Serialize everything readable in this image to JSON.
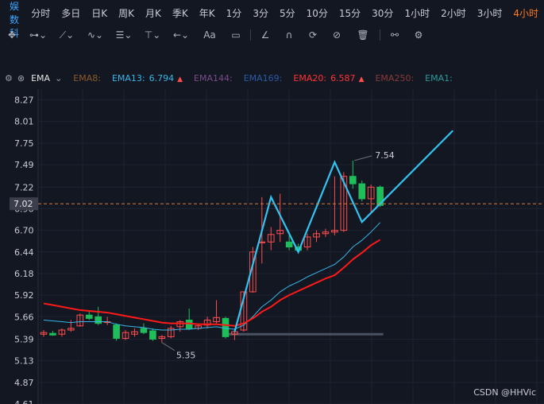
{
  "stock_name": "天娱数科",
  "timeframes": [
    "分时",
    "多日",
    "日K",
    "周K",
    "月K",
    "季K",
    "年K",
    "1分",
    "3分",
    "5分",
    "10分",
    "15分",
    "30分",
    "1小时",
    "2小时",
    "3小时",
    "4小时"
  ],
  "active_timeframe": "4小时",
  "toolbar": {
    "tools": [
      {
        "icon": "crosshair-icon",
        "glyph": "✥"
      },
      {
        "icon": "segment-line-icon",
        "glyph": "⊶⌄"
      },
      {
        "icon": "polyline-icon",
        "glyph": "⟋⌄"
      },
      {
        "icon": "wave-line-icon",
        "glyph": "∿⌄"
      },
      {
        "icon": "channel-icon",
        "glyph": "☰⌄"
      },
      {
        "icon": "vertical-line-icon",
        "glyph": "⊤⌄"
      },
      {
        "icon": "arrow-icon",
        "glyph": "←⌄"
      },
      {
        "icon": "text-icon",
        "glyph": "Aa"
      },
      {
        "icon": "comment-icon",
        "glyph": "▭"
      },
      {
        "icon": "pen-icon",
        "glyph": "∠"
      },
      {
        "icon": "magnet-icon",
        "glyph": "∩"
      },
      {
        "icon": "sync-icon",
        "glyph": "⟳"
      },
      {
        "icon": "hide-icon",
        "glyph": "⊘"
      },
      {
        "icon": "delete-icon",
        "glyph": "🗑"
      },
      {
        "icon": "link-icon",
        "glyph": "⚯"
      },
      {
        "icon": "settings-icon",
        "glyph": "⚙"
      }
    ]
  },
  "indicator_bar": {
    "name": "EMA",
    "items": [
      {
        "label": "EMA8:",
        "value": "",
        "color": "#8b5a2b",
        "arrow": ""
      },
      {
        "label": "EMA13:",
        "value": "6.794",
        "color": "#38b6e8",
        "arrow": "▲",
        "arrow_color": "#ff4d4d"
      },
      {
        "label": "EMA144:",
        "value": "",
        "color": "#7a4a8a",
        "arrow": ""
      },
      {
        "label": "EMA169:",
        "value": "",
        "color": "#2a5aa8",
        "arrow": ""
      },
      {
        "label": "EMA20:",
        "value": "6.587",
        "color": "#ff3333",
        "arrow": "▲",
        "arrow_color": "#ff4d4d"
      },
      {
        "label": "EMA250:",
        "value": "",
        "color": "#8a3a3a",
        "arrow": ""
      },
      {
        "label": "EMA1:",
        "value": "",
        "color": "#2a9a9a",
        "arrow": ""
      }
    ]
  },
  "chart_data": {
    "type": "candlestick",
    "y_ticks": [
      8.27,
      8.01,
      7.75,
      7.49,
      7.22,
      6.96,
      6.7,
      6.44,
      6.18,
      5.92,
      5.66,
      5.39,
      5.13,
      4.87,
      4.61
    ],
    "y_tick_labels": [
      "8.27",
      "8.01",
      "7.75",
      "7.49",
      "7.22",
      "6.96",
      "6.70",
      "6.44",
      "6.18",
      "5.92",
      "5.66",
      "5.39",
      "5.13",
      "4.87",
      "4.61"
    ],
    "ylim": [
      4.61,
      8.4
    ],
    "current_price": 7.02,
    "current_price_label": "7.02",
    "high_label": "7.54",
    "low_label": "5.35",
    "grid": true,
    "colors": {
      "up": "#ff4d4d",
      "down": "#1fbe5a",
      "ema13": "#38b6e8",
      "ema20": "#ff1a1a",
      "pattern": "#33c3f0",
      "level": "#4a5160",
      "price_line": "#d87a3a",
      "price_tag": "#3a3f4b"
    },
    "candles": [
      {
        "o": 5.45,
        "h": 5.5,
        "l": 5.42,
        "c": 5.47
      },
      {
        "o": 5.46,
        "h": 5.49,
        "l": 5.43,
        "c": 5.44
      },
      {
        "o": 5.45,
        "h": 5.52,
        "l": 5.42,
        "c": 5.5
      },
      {
        "o": 5.5,
        "h": 5.62,
        "l": 5.48,
        "c": 5.52
      },
      {
        "o": 5.55,
        "h": 5.7,
        "l": 5.54,
        "c": 5.68
      },
      {
        "o": 5.68,
        "h": 5.72,
        "l": 5.62,
        "c": 5.64
      },
      {
        "o": 5.66,
        "h": 5.78,
        "l": 5.56,
        "c": 5.58
      },
      {
        "o": 5.6,
        "h": 5.66,
        "l": 5.56,
        "c": 5.6
      },
      {
        "o": 5.56,
        "h": 5.58,
        "l": 5.37,
        "c": 5.4
      },
      {
        "o": 5.4,
        "h": 5.5,
        "l": 5.38,
        "c": 5.47
      },
      {
        "o": 5.45,
        "h": 5.52,
        "l": 5.42,
        "c": 5.48
      },
      {
        "o": 5.52,
        "h": 5.58,
        "l": 5.45,
        "c": 5.47
      },
      {
        "o": 5.49,
        "h": 5.52,
        "l": 5.37,
        "c": 5.39
      },
      {
        "o": 5.4,
        "h": 5.44,
        "l": 5.35,
        "c": 5.42
      },
      {
        "o": 5.42,
        "h": 5.55,
        "l": 5.4,
        "c": 5.52
      },
      {
        "o": 5.54,
        "h": 5.62,
        "l": 5.48,
        "c": 5.6
      },
      {
        "o": 5.62,
        "h": 5.76,
        "l": 5.5,
        "c": 5.52
      },
      {
        "o": 5.52,
        "h": 5.58,
        "l": 5.5,
        "c": 5.55
      },
      {
        "o": 5.56,
        "h": 5.66,
        "l": 5.52,
        "c": 5.62
      },
      {
        "o": 5.6,
        "h": 5.86,
        "l": 5.58,
        "c": 5.65
      },
      {
        "o": 5.64,
        "h": 5.66,
        "l": 5.4,
        "c": 5.42
      },
      {
        "o": 5.45,
        "h": 5.52,
        "l": 5.38,
        "c": 5.48
      },
      {
        "o": 5.5,
        "h": 5.96,
        "l": 5.48,
        "c": 5.96
      },
      {
        "o": 5.96,
        "h": 6.5,
        "l": 5.95,
        "c": 6.44
      },
      {
        "o": 6.56,
        "h": 7.1,
        "l": 6.3,
        "c": 6.56
      },
      {
        "o": 6.56,
        "h": 6.74,
        "l": 6.46,
        "c": 6.65
      },
      {
        "o": 6.66,
        "h": 7.14,
        "l": 6.56,
        "c": 6.7
      },
      {
        "o": 6.56,
        "h": 6.64,
        "l": 6.46,
        "c": 6.5
      },
      {
        "o": 6.5,
        "h": 6.54,
        "l": 6.42,
        "c": 6.46
      },
      {
        "o": 6.5,
        "h": 6.66,
        "l": 6.46,
        "c": 6.62
      },
      {
        "o": 6.62,
        "h": 6.7,
        "l": 6.56,
        "c": 6.66
      },
      {
        "o": 6.66,
        "h": 6.72,
        "l": 6.62,
        "c": 6.68
      },
      {
        "o": 6.68,
        "h": 7.35,
        "l": 6.64,
        "c": 6.7
      },
      {
        "o": 6.7,
        "h": 7.4,
        "l": 6.68,
        "c": 7.35
      },
      {
        "o": 7.35,
        "h": 7.54,
        "l": 7.2,
        "c": 7.26
      },
      {
        "o": 7.26,
        "h": 7.3,
        "l": 7.05,
        "c": 7.08
      },
      {
        "o": 7.08,
        "h": 7.25,
        "l": 6.92,
        "c": 7.22
      },
      {
        "o": 7.22,
        "h": 7.24,
        "l": 6.98,
        "c": 7.0
      }
    ],
    "ema13": [
      5.62,
      5.61,
      5.6,
      5.59,
      5.6,
      5.6,
      5.6,
      5.6,
      5.57,
      5.55,
      5.54,
      5.53,
      5.51,
      5.5,
      5.5,
      5.51,
      5.51,
      5.52,
      5.53,
      5.54,
      5.52,
      5.51,
      5.56,
      5.66,
      5.78,
      5.86,
      5.96,
      6.03,
      6.08,
      6.14,
      6.19,
      6.24,
      6.29,
      6.38,
      6.5,
      6.58,
      6.68,
      6.794
    ],
    "ema20": [
      5.82,
      5.8,
      5.78,
      5.76,
      5.74,
      5.73,
      5.72,
      5.71,
      5.69,
      5.67,
      5.65,
      5.63,
      5.61,
      5.59,
      5.58,
      5.58,
      5.58,
      5.57,
      5.57,
      5.57,
      5.56,
      5.55,
      5.58,
      5.64,
      5.72,
      5.78,
      5.86,
      5.92,
      5.97,
      6.02,
      6.07,
      6.12,
      6.16,
      6.25,
      6.35,
      6.43,
      6.52,
      6.587
    ],
    "level_line": {
      "value": 5.45,
      "from": 20,
      "to": 37
    },
    "pattern_line": [
      [
        21,
        5.48
      ],
      [
        25,
        7.1
      ],
      [
        28,
        6.44
      ],
      [
        32,
        7.52
      ],
      [
        35,
        6.8
      ],
      [
        45,
        7.9
      ]
    ]
  },
  "watermark": "CSDN @HHVic"
}
